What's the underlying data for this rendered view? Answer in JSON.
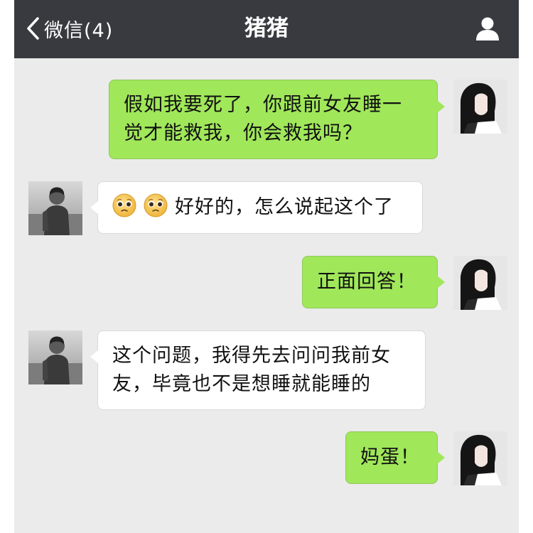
{
  "header": {
    "back_label": "微信(4)",
    "title": "猪猪",
    "back_icon": "chevron-left-icon",
    "profile_icon": "person-icon"
  },
  "colors": {
    "topbar": "#393a3f",
    "chat_background": "#ebebeb",
    "outgoing_bubble": "#a0e75a",
    "incoming_bubble": "#ffffff"
  },
  "messages": [
    {
      "sender": "me",
      "text_line1": "假如我要死了，你跟前女友睡一",
      "text_line2": "觉才能救我，你会救我吗？"
    },
    {
      "sender": "other",
      "emojis": [
        "pleading-face-emoji",
        "pleading-face-emoji"
      ],
      "text": "好好的，怎么说起这个了"
    },
    {
      "sender": "me",
      "text": "正面回答！"
    },
    {
      "sender": "other",
      "text_line1": "这个问题，我得先去问问我前女",
      "text_line2": "友，毕竟也不是想睡就能睡的"
    },
    {
      "sender": "me",
      "text": "妈蛋！"
    }
  ]
}
